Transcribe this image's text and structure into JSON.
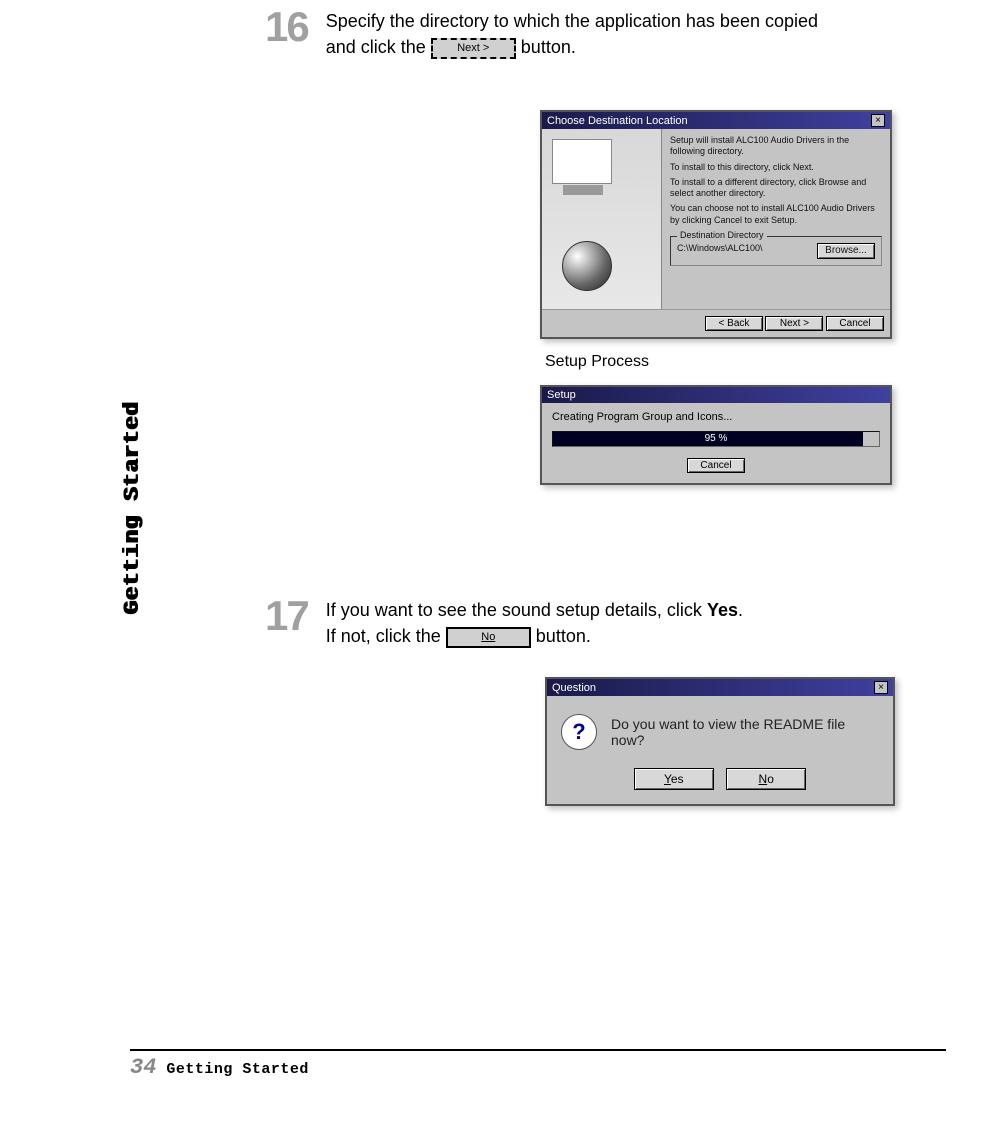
{
  "sidetab": "Getting Started",
  "steps": {
    "s16": {
      "num": "16",
      "line1_a": "Specify the directory to which the application has been copied",
      "line2_a": "and click the ",
      "btn_label": "Next >",
      "line2_b": " button."
    },
    "s17": {
      "num": "17",
      "line1_a": "If you want to see the sound setup details, click ",
      "line1_b": "Yes",
      "line1_c": ".",
      "line2_a": "If not, click the ",
      "btn_label": "No",
      "line2_b": " button."
    }
  },
  "window1": {
    "title": "Choose Destination Location",
    "p1": "Setup will install ALC100 Audio Drivers in the following directory.",
    "p2": "To install to this directory, click Next.",
    "p3": "To install to a different directory, click Browse and select another directory.",
    "p4": "You can choose not to install ALC100 Audio Drivers by clicking Cancel to exit Setup.",
    "dest_legend": "Destination Directory",
    "dest_path": "C:\\Windows\\ALC100\\",
    "browse": "Browse...",
    "btn_back": "< Back",
    "btn_next": "Next >",
    "btn_cancel": "Cancel"
  },
  "caption1": "Setup Process",
  "window2": {
    "title": "Setup",
    "status": "Creating Program Group and Icons...",
    "percent": "95 %",
    "cancel": "Cancel"
  },
  "window3": {
    "title": "Question",
    "icon": "?",
    "message": "Do you want to view the README file now?",
    "yes_u": "Y",
    "yes_rest": "es",
    "no_u": "N",
    "no_rest": "o"
  },
  "footer": {
    "page": "34",
    "title": "Getting Started"
  }
}
